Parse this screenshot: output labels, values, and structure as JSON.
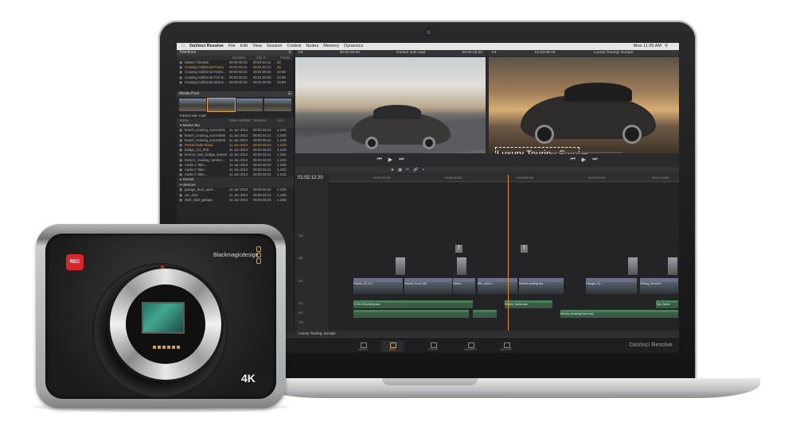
{
  "menubar": {
    "app": "DaVinci Resolve",
    "items": [
      "File",
      "Edit",
      "View",
      "Session",
      "Control",
      "Nodes",
      "Memory",
      "Dynamics"
    ],
    "clock": "Mon 11:20 AM"
  },
  "timelines_panel": {
    "title": "Timelines",
    "columns": [
      "Duration",
      "Clip In",
      "Frame"
    ],
    "rows": [
      {
        "name": "Master Timeline",
        "c1": "00:00:46:22",
        "c2": "00:01:34:11",
        "c3": "30",
        "hl": false
      },
      {
        "name": "Cruising California Promo",
        "c1": "00:01:34:11",
        "c2": "00:01:34:11",
        "c3": "30",
        "hl": true
      },
      {
        "name": "Cruising California Festiv...",
        "c1": "00:00:46:22",
        "c2": "00:01:00:02",
        "c3": "23.98",
        "hl": false
      },
      {
        "name": "Cruising California TVC E...",
        "c1": "00:00:46:22",
        "c2": "00:01:00:02",
        "c3": "23.98",
        "hl": false
      },
      {
        "name": "Cruising California Web E...",
        "c1": "00:00:46:22",
        "c2": "00:01:00:02",
        "c3": "23.98",
        "hl": false
      }
    ]
  },
  "media_pool": {
    "title": "Media Pool",
    "selected_clip": "Parked side road",
    "columns": [
      "Name",
      "Date modified",
      "Duration",
      "Size"
    ],
    "bin": "Master Bin",
    "rows": [
      {
        "name": "beach_cruising_sunset001",
        "c1": "11 Jun 2012",
        "c2": "00:00:46:22",
        "c3": "1.1Gb",
        "hl": false
      },
      {
        "name": "beach_cruising_sunset002",
        "c1": "11 Jun 2012",
        "c2": "00:00:34:11",
        "c3": "1.4Gb",
        "hl": false
      },
      {
        "name": "beach_cruising_sunset003",
        "c1": "11 Jun 2012",
        "c2": "00:00:46:22",
        "c3": "1.1Gb",
        "hl": false
      },
      {
        "name": "Parked Side Road",
        "c1": "11 Jun 2012",
        "c2": "00:00:46:22",
        "c3": "1.1Gb",
        "hl": true
      },
      {
        "name": "badge_CU_003",
        "c1": "11 Jun 2012",
        "c2": "00:00:46:22",
        "c3": "1.1Gb",
        "hl": false
      },
      {
        "name": "bonnet_cam_badge_sunset",
        "c1": "11 Jun 2012",
        "c2": "00:00:34:11",
        "c3": "1.4Gb",
        "hl": false
      },
      {
        "name": "interior_cruising_cambor...",
        "c1": "11 Jun 2012",
        "c2": "00:00:46:22",
        "c3": "1.1Gb",
        "hl": false
      },
      {
        "name": "Audio 1 Take...",
        "c1": "11 Jun 2012",
        "c2": "00:00:46:22",
        "c3": "1.1Gb",
        "hl": false
      },
      {
        "name": "Audio 2 Take...",
        "c1": "11 Jun 2012",
        "c2": "00:00:34:11",
        "c3": "1.4Gb",
        "hl": false
      },
      {
        "name": "Audio 3 Take...",
        "c1": "11 Jun 2012",
        "c2": "00:00:46:22",
        "c3": "1.1Gb",
        "hl": false
      }
    ],
    "sub_bins": [
      "Sunset",
      "Interiors"
    ],
    "rows2": [
      {
        "name": "garage_door_open...",
        "c1": "11 Jun 2012",
        "c2": "00:00:46:22",
        "c3": "1.1Gb",
        "hl": false
      },
      {
        "name": "car_door",
        "c1": "11 Jun 2012",
        "c2": "00:00:34:11",
        "c3": "1.4Gb",
        "hl": false
      },
      {
        "name": "dark_start_garage",
        "c1": "11 Jun 2012",
        "c2": "00:00:46:22",
        "c3": "1.1Gb",
        "hl": false
      }
    ]
  },
  "source_viewer": {
    "label": "Fit",
    "timecode": "00:00:00:03",
    "clip_name": "Parked side road",
    "duration": "00:02:15:10"
  },
  "record_viewer": {
    "label": "Fit",
    "timecode": "01:03:08:19",
    "timeline_name": "Luxury Touring: Europe"
  },
  "overlay_title": {
    "main": "Luxury Touring",
    "accent": "Europe"
  },
  "timeline": {
    "timecode": "01:02:12:20",
    "ruler": [
      "00:00:30:00",
      "00:00:40:00",
      "00:00:50:00",
      "00:01:00:00",
      "00:01:10:00"
    ],
    "tracks": [
      "V3",
      "V2",
      "V1",
      "A1",
      "A2",
      "A3"
    ],
    "video_clips": [
      "Parked_34_CU",
      "Parked_Front_3M",
      "Interio...",
      "Rim_shot 0...",
      "Sunset cruising low",
      "Garage_Co...",
      "Driving_Sunset0..."
    ],
    "audio_clips": [
      "VI Mix Recording.wav",
      "Engine_Noise.wav",
      "Electric_BackingTrack.wav",
      "Tyre_Noise"
    ],
    "footer": "Luxury Touring: Europe"
  },
  "pages": [
    {
      "label": "MEDIA",
      "active": false
    },
    {
      "label": "EDIT",
      "active": true
    },
    {
      "label": "COLOR",
      "active": false
    },
    {
      "label": "GALLERY",
      "active": false
    },
    {
      "label": "DELIVER",
      "active": false
    }
  ],
  "brand": "DaVinci Resolve",
  "camera": {
    "rec_label": "REC",
    "logo": "Blackmagicdesign",
    "badge": "4K"
  },
  "colors": {
    "accent": "#f0a030",
    "rec_red": "#d9262a"
  }
}
